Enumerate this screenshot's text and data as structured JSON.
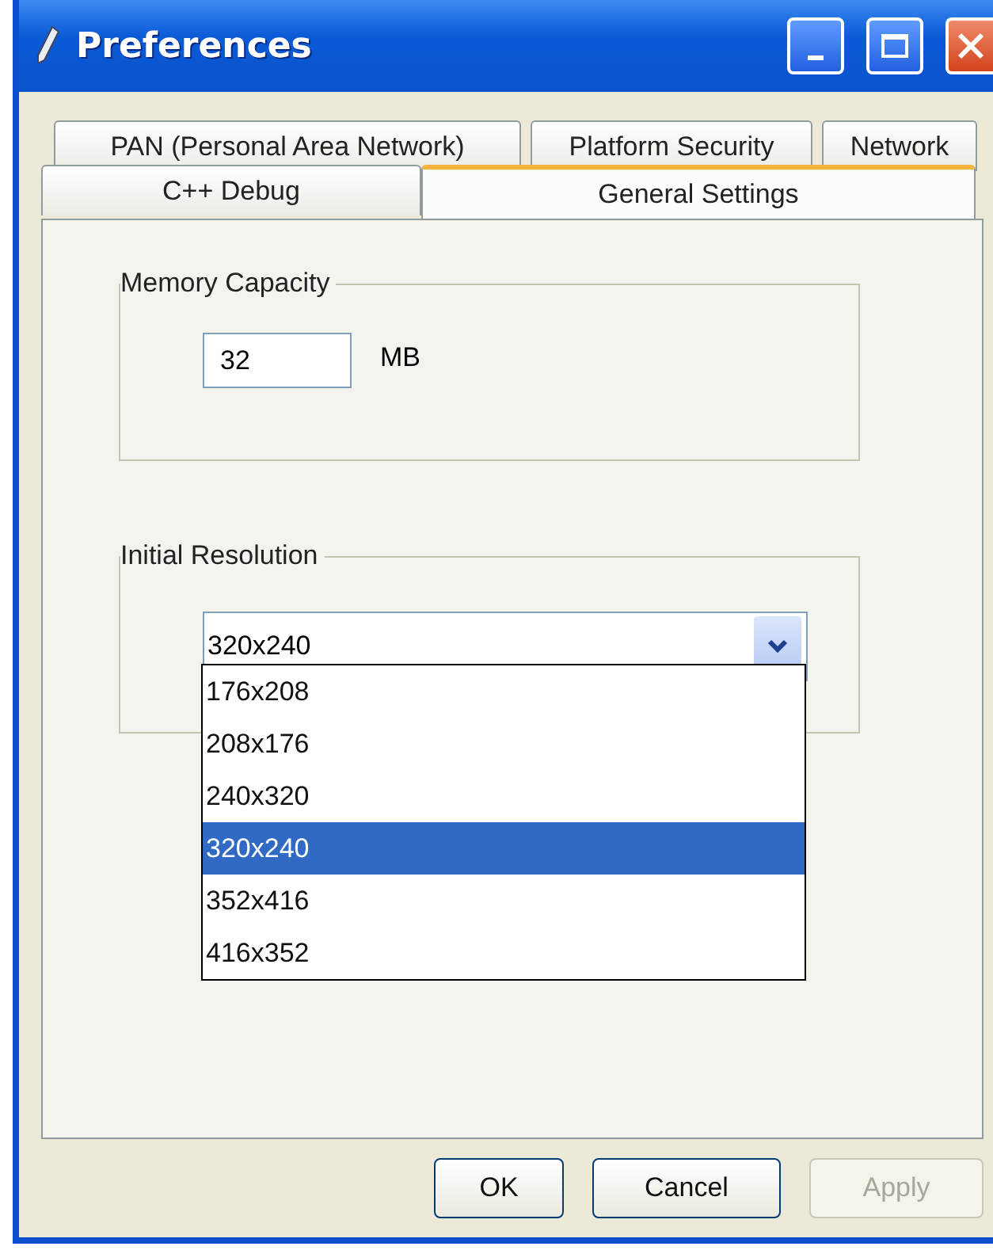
{
  "window": {
    "title": "Preferences"
  },
  "tab_rows": [
    [
      {
        "label": "PAN (Personal Area Network)",
        "selected": false
      },
      {
        "label": "Platform Security",
        "selected": false
      },
      {
        "label": "Network",
        "selected": false
      }
    ],
    [
      {
        "label": "C++ Debug",
        "selected": false
      },
      {
        "label": "General Settings",
        "selected": true
      }
    ]
  ],
  "memory_capacity": {
    "title": "Memory Capacity",
    "value": "32",
    "unit": "MB"
  },
  "initial_resolution": {
    "title": "Initial Resolution",
    "value": "320x240",
    "expanded": true,
    "options": [
      {
        "label": "176x208",
        "selected": false
      },
      {
        "label": "208x176",
        "selected": false
      },
      {
        "label": "240x320",
        "selected": false
      },
      {
        "label": "320x240",
        "selected": true
      },
      {
        "label": "352x416",
        "selected": false
      },
      {
        "label": "416x352",
        "selected": false
      }
    ]
  },
  "buttons": [
    {
      "label": "OK",
      "disabled": false
    },
    {
      "label": "Cancel",
      "disabled": false
    },
    {
      "label": "Apply",
      "disabled": true
    }
  ]
}
